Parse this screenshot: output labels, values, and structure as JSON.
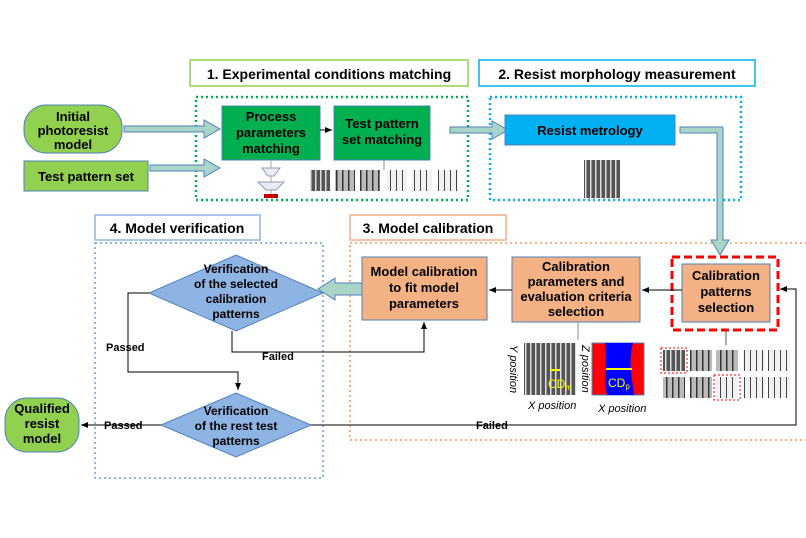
{
  "colors": {
    "green_light": "#92d050",
    "green": "#00b050",
    "blue": "#00b0f0",
    "orange": "#f4b183",
    "diamond": "#8eb4e3",
    "red": "#ff0000",
    "cd_blue": "#0000ff",
    "cd_label": "#ffff00"
  },
  "sections": {
    "s1": "1. Experimental conditions matching",
    "s2": "2. Resist morphology measurement",
    "s3": "3. Model calibration",
    "s4": "4. Model verification"
  },
  "inputs": {
    "initial_model": [
      "Initial",
      "photoresist",
      "model"
    ],
    "test_pattern_set": "Test pattern set"
  },
  "boxes": {
    "process": [
      "Process",
      "parameters",
      "matching"
    ],
    "test_matching": [
      "Test pattern",
      "set matching"
    ],
    "metrology": "Resist metrology",
    "cal_patterns": [
      "Calibration",
      "patterns",
      "selection"
    ],
    "cal_params": [
      "Calibration",
      "parameters and",
      "evaluation criteria",
      "selection"
    ],
    "model_cal": [
      "Model calibration",
      "to fit model",
      "parameters"
    ],
    "verify_selected": [
      "Verification",
      "of the selected",
      "calibration",
      "patterns"
    ],
    "verify_rest": [
      "Verification",
      "of the rest test",
      "patterns"
    ],
    "qualified": [
      "Qualified",
      "resist",
      "model"
    ]
  },
  "labels": {
    "passed": "Passed",
    "failed": "Failed",
    "y_position": "Y position",
    "z_position": "Z position",
    "x_position": "X position",
    "cd_m": "CD",
    "cd_m_sub": "m",
    "cd_p": "CD",
    "cd_p_sub": "p"
  }
}
